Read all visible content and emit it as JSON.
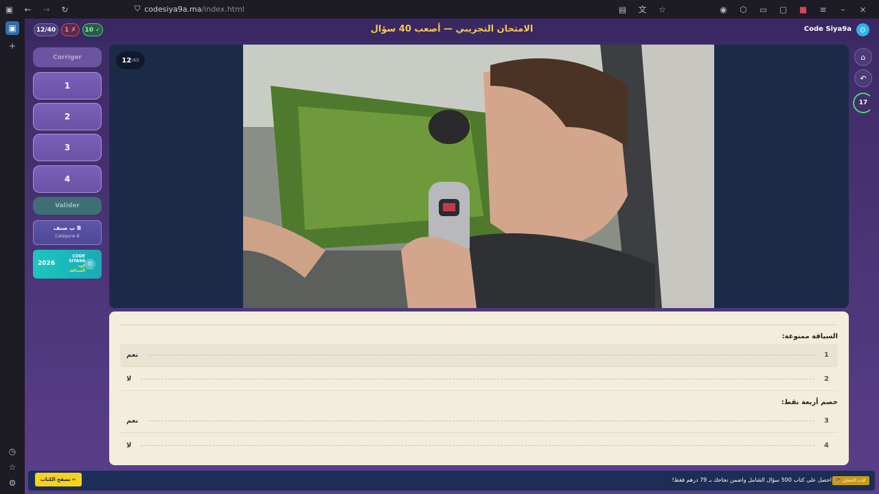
{
  "browser": {
    "url_host": "codesiya9a.ma",
    "url_path": "/index.html",
    "icons": [
      "sidebar-toggle-icon",
      "back-icon",
      "forward-icon",
      "reload-icon",
      "shield-icon",
      "reader-icon",
      "translate-icon",
      "bookmark-icon",
      "account-icon",
      "extensions-icon",
      "tab-icon",
      "screenshot-icon",
      "badge-icon",
      "menu-icon",
      "minimize-icon",
      "close-icon"
    ]
  },
  "topbar": {
    "progress": "12/40",
    "wrong": "1 ✗",
    "correct": "10 ✓",
    "title": "الامتحان التجريبي — أصعب 40 سؤال",
    "brand": "Code Siya9a"
  },
  "answers": {
    "corriger": "Corriger",
    "buttons": [
      "1",
      "2",
      "3",
      "4"
    ],
    "valider": "Valider"
  },
  "category": {
    "ar": "ب صنف B",
    "fr": "Catégorie B"
  },
  "promo": {
    "year": "2026",
    "line1": "CODE",
    "line2": "SIYA9A",
    "line3": "كود",
    "line4": "السياقة"
  },
  "image_panel": {
    "counter_current": "12",
    "counter_total": "/40"
  },
  "right_rail": {
    "timer": "17"
  },
  "question": {
    "q1": "السياقة ممنوعة:",
    "q2": "خصم أربعة نقط:",
    "options": [
      {
        "n": "1",
        "text": "نعم"
      },
      {
        "n": "2",
        "text": "لا"
      },
      {
        "n": "3",
        "text": "نعم"
      },
      {
        "n": "4",
        "text": "لا"
      }
    ]
  },
  "footer": {
    "button": "تصفح الكتاب ←",
    "text": "احصل على كتاب 500 سؤال الشامل واضمن نجاحك بـ 79 درهم فقط!",
    "tag": "📚 كتاب الامتحان"
  },
  "colors": {
    "accent": "#f6c94b",
    "correct": "#46d47a",
    "wrong": "#e0435a",
    "panel": "#f3eedb"
  }
}
